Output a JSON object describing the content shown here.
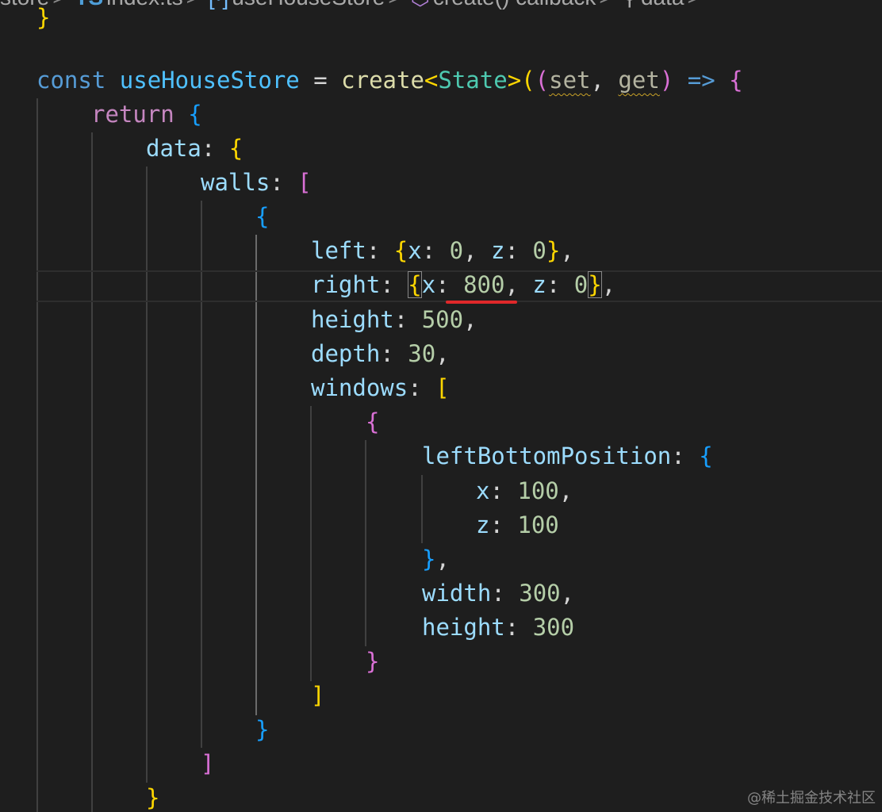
{
  "breadcrumb": {
    "items": [
      "store",
      "index.ts",
      "useHouseStore",
      "create() callback",
      "data"
    ],
    "file_badge": "TS",
    "separator": ">"
  },
  "code": {
    "prev_line_tail": "}",
    "const_kw": "const",
    "store_name": "useHouseStore",
    "assign": " = ",
    "create_fn": "create",
    "type_open": "<",
    "type_name": "State",
    "type_close": ">",
    "param_set": "set",
    "param_get": "get",
    "comma": ", ",
    "arrow": " => ",
    "return_kw": "return",
    "data_key": "data",
    "walls_key": "walls",
    "left_key": "left",
    "right_key": "right",
    "x_key": "x",
    "z_key": "z",
    "height_key": "height",
    "depth_key": "depth",
    "windows_key": "windows",
    "lbp_key": "leftBottomPosition",
    "width_key": "width",
    "left_x": "0",
    "left_z": "0",
    "right_x": "800",
    "right_z": "0",
    "wall_height": "500",
    "wall_depth": "30",
    "lbp_x": "100",
    "lbp_z": "100",
    "window_width": "300",
    "window_height": "300"
  },
  "watermark": "@稀土掘金技术社区",
  "colors": {
    "background": "#1e1e1e",
    "annotation_underline": "#e0282a"
  }
}
